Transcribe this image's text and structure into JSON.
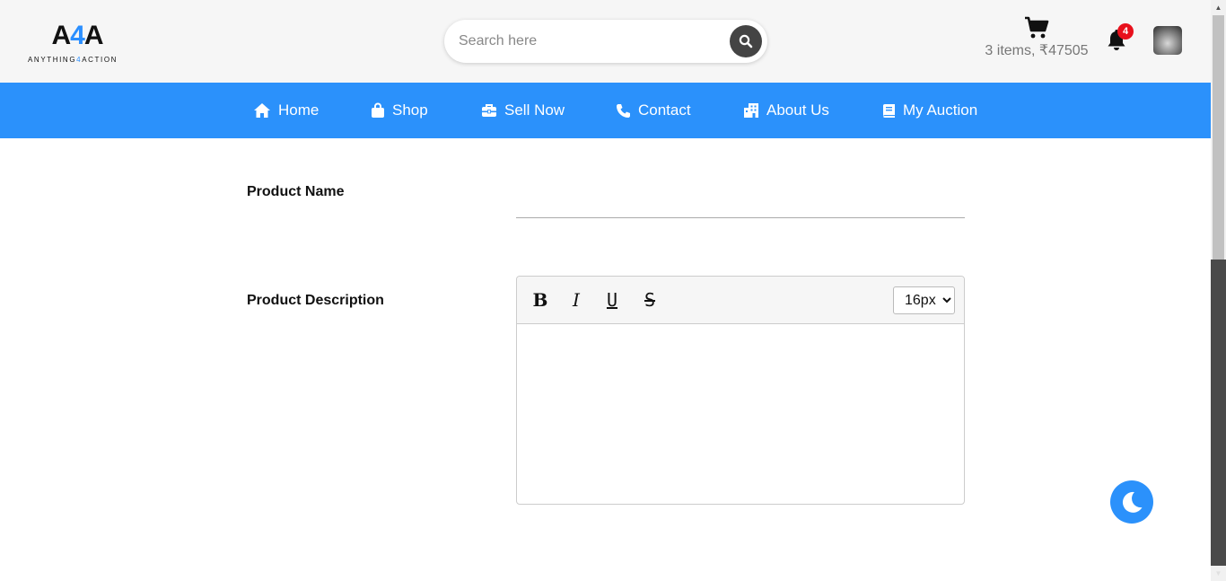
{
  "header": {
    "logo": {
      "mark_a1": "A",
      "mark_4": "4",
      "mark_a2": "A",
      "sub_pre": "ANYTHING",
      "sub_4": "4",
      "sub_post": "ACTION"
    },
    "search": {
      "placeholder": "Search here",
      "value": ""
    },
    "cart": {
      "summary": "3 items, ₹47505"
    },
    "notifications": {
      "count": "4"
    }
  },
  "nav": {
    "items": [
      {
        "label": "Home",
        "icon": "home-icon"
      },
      {
        "label": "Shop",
        "icon": "shopping-bag-icon"
      },
      {
        "label": "Sell Now",
        "icon": "toolbox-icon"
      },
      {
        "label": "Contact",
        "icon": "phone-icon"
      },
      {
        "label": "About Us",
        "icon": "building-icon"
      },
      {
        "label": "My Auction",
        "icon": "book-icon"
      }
    ]
  },
  "form": {
    "product_name_label": "Product Name",
    "product_name_value": "",
    "product_description_label": "Product Description",
    "editor": {
      "bold": "B",
      "italic": "I",
      "underline": "U",
      "strike": "S",
      "font_size": "16px",
      "font_size_options": [
        "16px"
      ],
      "content": ""
    }
  },
  "colors": {
    "accent": "#2b91fb",
    "badge": "#e8101c",
    "header_bg": "#f6f6f6"
  }
}
